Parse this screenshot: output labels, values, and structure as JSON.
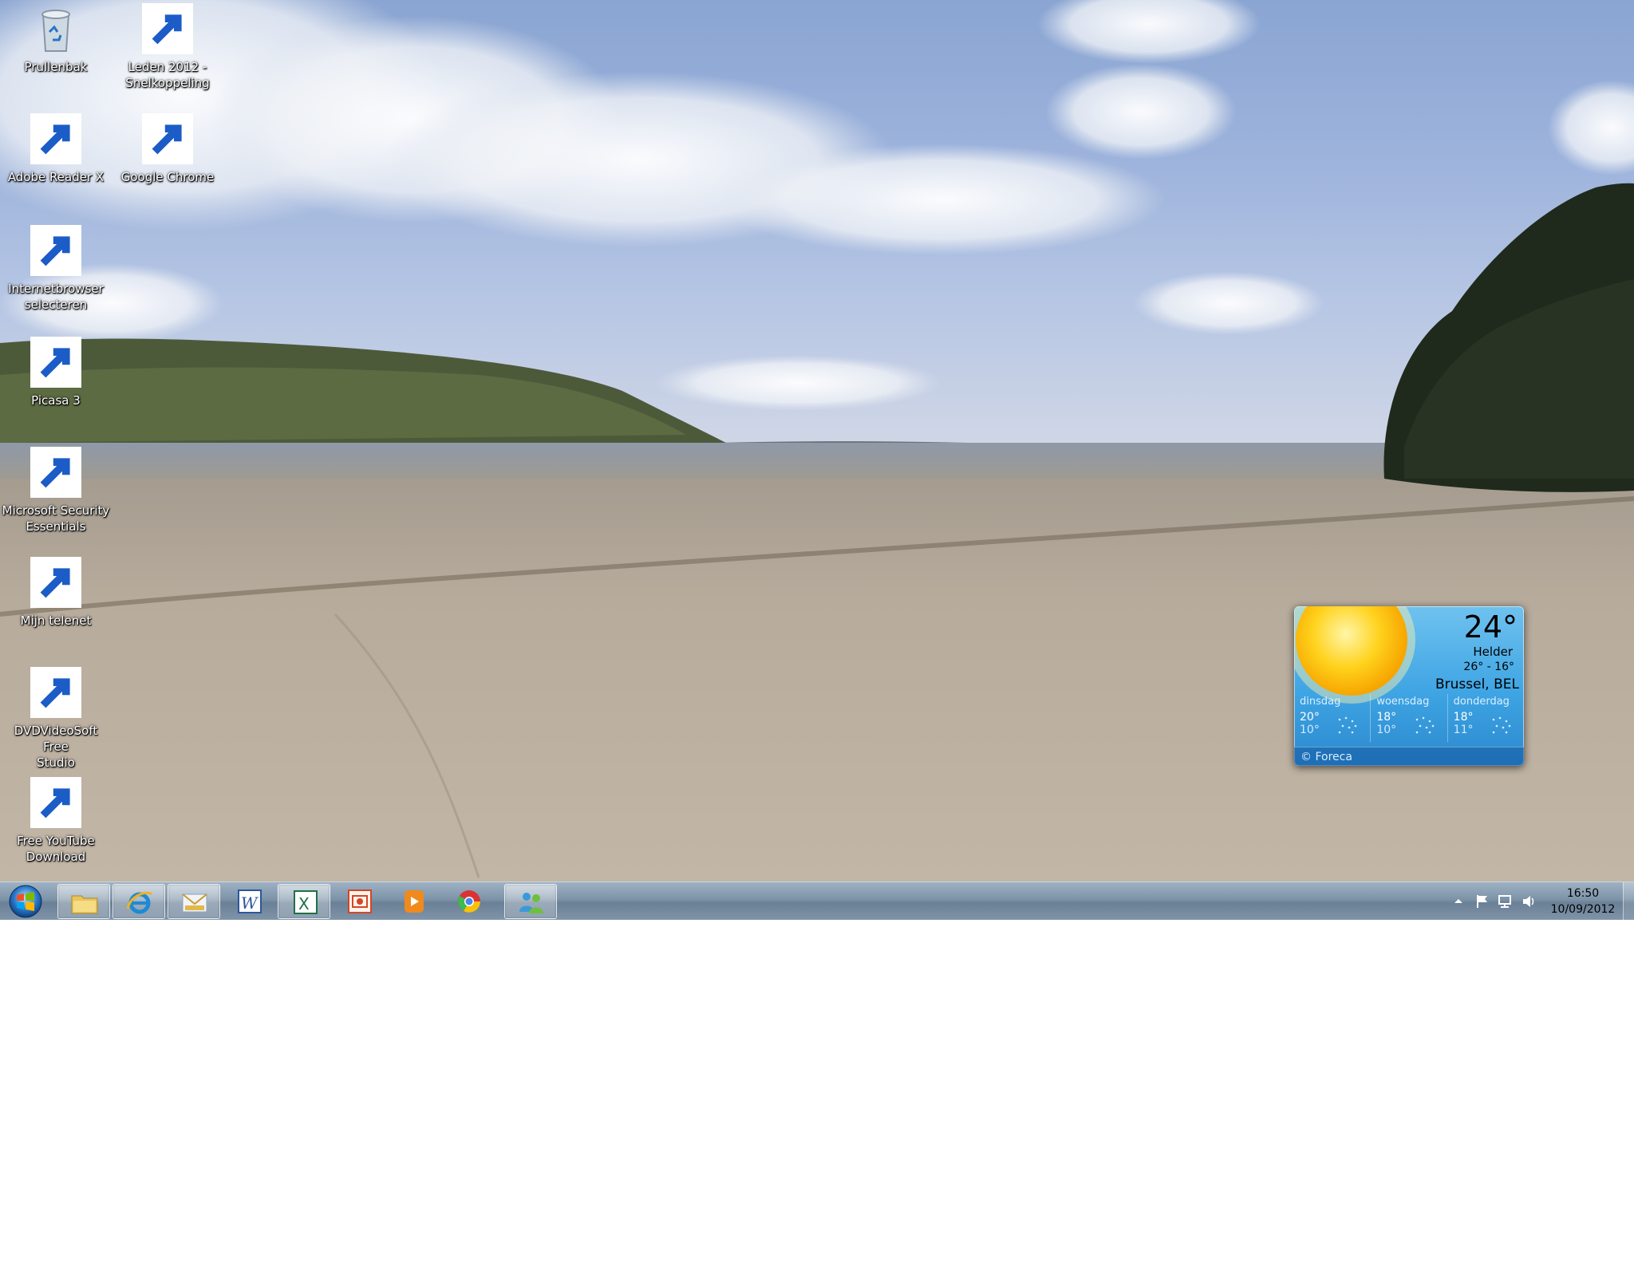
{
  "desktop": {
    "icons": [
      {
        "label": "Prullenbak",
        "icon": "recycle-bin-icon"
      },
      {
        "label": "Leden 2012 -\nSnelkoppeling",
        "icon": "excel-document-icon"
      },
      {
        "label": "Adobe Reader X",
        "icon": "adobe-reader-icon"
      },
      {
        "label": "Google Chrome",
        "icon": "chrome-icon"
      },
      {
        "label": "Internetbrowser\nselecteren",
        "icon": "browser-choice-icon"
      },
      {
        "label": "Picasa 3",
        "icon": "picasa-icon"
      },
      {
        "label": "Microsoft Security\nEssentials",
        "icon": "security-essentials-icon"
      },
      {
        "label": "Mijn telenet",
        "icon": "telenet-icon"
      },
      {
        "label": "DVDVideoSoft Free\nStudio",
        "icon": "dvdvideosoft-icon"
      },
      {
        "label": "Free YouTube\nDownload",
        "icon": "youtube-download-icon"
      }
    ]
  },
  "weather": {
    "temperature": "24°",
    "condition": "Helder",
    "range": "26°  -  16°",
    "location": "Brussel, BEL",
    "forecast": [
      {
        "day": "dinsdag",
        "high": "20°",
        "low": "10°"
      },
      {
        "day": "woensdag",
        "high": "18°",
        "low": "10°"
      },
      {
        "day": "donderdag",
        "high": "18°",
        "low": "11°"
      }
    ],
    "footer": "© Foreca",
    "colors": {
      "panel": "#3ea4e3",
      "sun": "#ffd21c"
    }
  },
  "taskbar": {
    "start_icon": "windows-start-orb-icon",
    "buttons": [
      {
        "icon": "windows-explorer-icon",
        "open": true
      },
      {
        "icon": "internet-explorer-icon",
        "open": true
      },
      {
        "icon": "windows-mail-icon",
        "open": true
      },
      {
        "icon": "word-icon",
        "open": false
      },
      {
        "icon": "excel-icon",
        "open": true
      },
      {
        "icon": "powerpoint-icon",
        "open": false
      },
      {
        "icon": "media-player-icon",
        "open": false
      },
      {
        "icon": "chrome-icon",
        "open": false
      },
      {
        "icon": "messenger-icon",
        "open": true
      }
    ],
    "tray_icons": [
      "show-hidden-icons-icon",
      "action-center-flag-icon",
      "network-icon",
      "volume-icon"
    ],
    "clock": {
      "time": "16:50",
      "date": "10/09/2012"
    }
  }
}
